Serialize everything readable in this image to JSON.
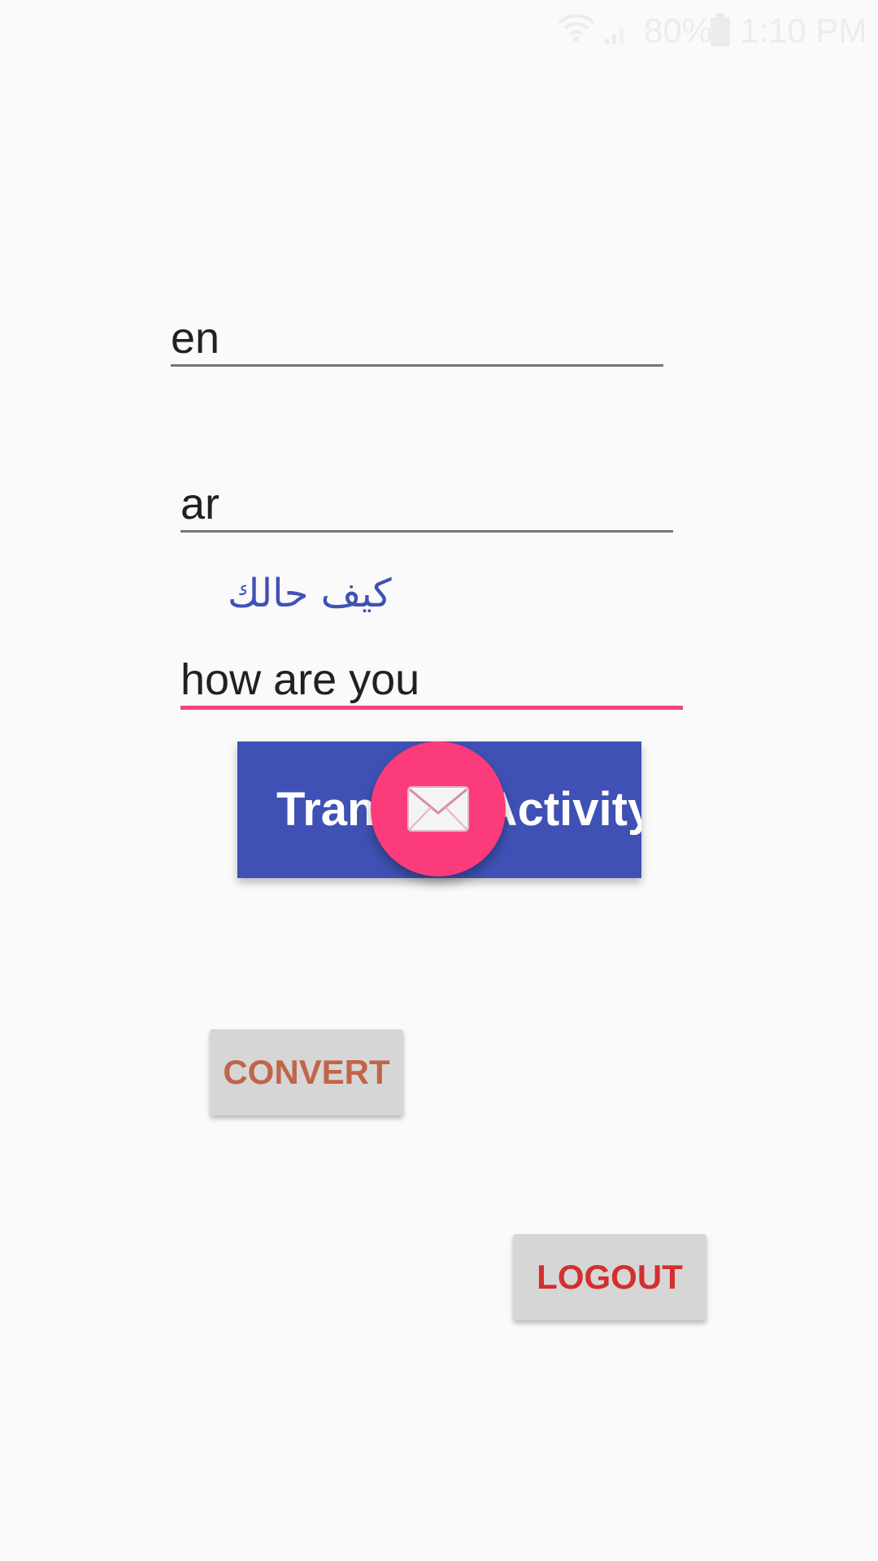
{
  "status_bar": {
    "battery_percent": "80%",
    "time": "1:10 PM",
    "icons": [
      "wifi-icon",
      "signal-icon",
      "battery-icon"
    ]
  },
  "fields": {
    "source_language": "en",
    "target_language": "ar",
    "input_text": "how are you"
  },
  "translated_text": "كيف حالك",
  "activity_button": {
    "label": "TranslateActivity"
  },
  "fab": {
    "icon": "mail-icon",
    "color": "#fc3b7b"
  },
  "buttons": {
    "convert": "CONVERT",
    "logout": "LOGOUT"
  },
  "colors": {
    "primary": "#3f51b5",
    "accent": "#f0457e",
    "background": "#fafafa"
  }
}
